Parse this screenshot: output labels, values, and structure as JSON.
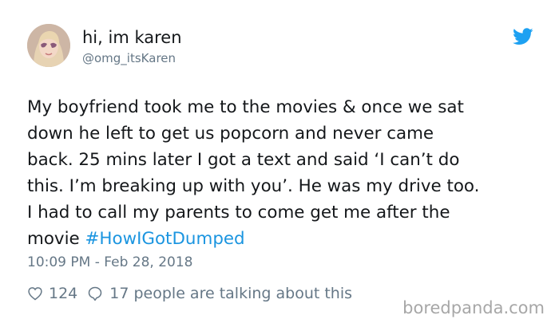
{
  "tweet": {
    "author": {
      "display_name": "hi, im karen",
      "handle": "@omg_itsKaren",
      "avatar": "user-avatar-photo"
    },
    "text_lines": [
      "My boyfriend took me to the movies & once we sat",
      "down he left to get us popcorn and never came",
      "back. 25 mins later I got a text and said ‘I can’t do",
      "this. I’m breaking up with you’. He was my drive too.",
      "I had to call my parents to come get me after the",
      "movie "
    ],
    "hashtag": "#HowIGotDumped",
    "timestamp": "10:09 PM - Feb 28, 2018",
    "likes": "124",
    "talking": "17 people are talking about this"
  },
  "icons": {
    "brand": "twitter-bird-icon",
    "like": "heart-outline-icon",
    "reply": "speech-bubble-icon"
  },
  "colors": {
    "link": "#1b95e0",
    "twitter_blue": "#1da1f2",
    "secondary_text": "#657786",
    "primary_text": "#14171a",
    "watermark": "#a7a7a7"
  },
  "watermark": "boredpanda.com"
}
